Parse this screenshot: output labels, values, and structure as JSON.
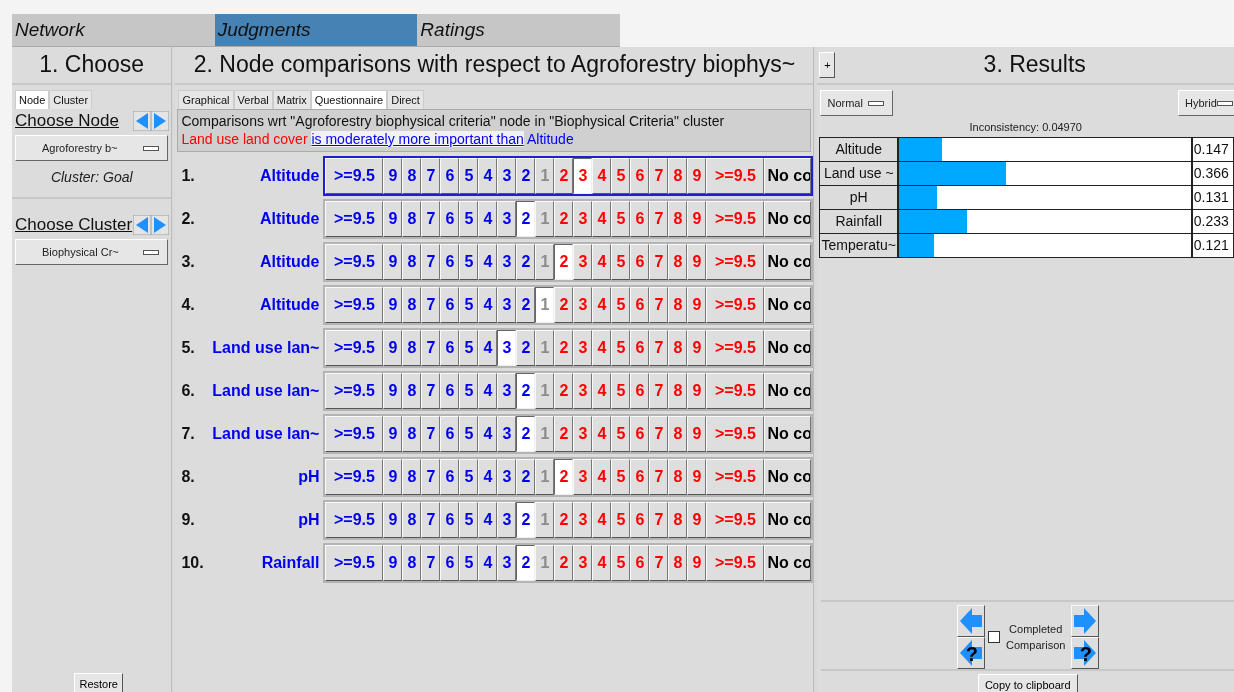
{
  "tabs": [
    {
      "label": "Network",
      "selected": false
    },
    {
      "label": "Judgments",
      "selected": true
    },
    {
      "label": "Ratings",
      "selected": false
    }
  ],
  "choose": {
    "title": "1. Choose",
    "tabs": [
      {
        "label": "Node",
        "selected": true
      },
      {
        "label": "Cluster",
        "selected": false
      }
    ],
    "node_heading": "Choose Node",
    "node_dropdown": "Agroforestry b~",
    "cluster_note": "Cluster: Goal",
    "cluster_heading": "Choose Cluster",
    "cluster_dropdown": "Biophysical Cr~",
    "restore_button": "Restore"
  },
  "comparisons": {
    "title": "2. Node comparisons with respect to Agroforestry biophys~",
    "tabs": [
      {
        "label": "Graphical",
        "selected": false
      },
      {
        "label": "Verbal",
        "selected": false
      },
      {
        "label": "Matrix",
        "selected": false
      },
      {
        "label": "Questionnaire",
        "selected": true
      },
      {
        "label": "Direct",
        "selected": false
      }
    ],
    "description": "Comparisons wrt \"Agroforestry biophysical criteria\" node in \"Biophysical Criteria\" cluster",
    "verbal": {
      "subject": "Land use land cover",
      "relation": "is moderately more important than",
      "object": "Altitude"
    },
    "rows": [
      {
        "number": "1.",
        "label": "Altitude",
        "current": true,
        "cells": [
          {
            "label": ">=9.5",
            "kind": "left",
            "selected": false
          },
          {
            "label": "9",
            "kind": "left",
            "selected": false
          },
          {
            "label": "8",
            "kind": "left",
            "selected": false
          },
          {
            "label": "7",
            "kind": "left",
            "selected": false
          },
          {
            "label": "6",
            "kind": "left",
            "selected": false
          },
          {
            "label": "5",
            "kind": "left",
            "selected": false
          },
          {
            "label": "4",
            "kind": "left",
            "selected": false
          },
          {
            "label": "3",
            "kind": "left",
            "selected": false
          },
          {
            "label": "2",
            "kind": "left",
            "selected": false
          },
          {
            "label": "1",
            "kind": "equal",
            "selected": false
          },
          {
            "label": "2",
            "kind": "right",
            "selected": false
          },
          {
            "label": "3",
            "kind": "right",
            "selected": true
          },
          {
            "label": "4",
            "kind": "right",
            "selected": false
          },
          {
            "label": "5",
            "kind": "right",
            "selected": false
          },
          {
            "label": "6",
            "kind": "right",
            "selected": false
          },
          {
            "label": "7",
            "kind": "right",
            "selected": false
          },
          {
            "label": "8",
            "kind": "right",
            "selected": false
          },
          {
            "label": "9",
            "kind": "right",
            "selected": false
          },
          {
            "label": ">=9.5",
            "kind": "right",
            "selected": false
          },
          {
            "label": "No co",
            "kind": "none",
            "selected": false
          }
        ]
      },
      {
        "number": "2.",
        "label": "Altitude",
        "current": false,
        "cells": [
          {
            "label": ">=9.5",
            "kind": "left",
            "selected": false
          },
          {
            "label": "9",
            "kind": "left",
            "selected": false
          },
          {
            "label": "8",
            "kind": "left",
            "selected": false
          },
          {
            "label": "7",
            "kind": "left",
            "selected": false
          },
          {
            "label": "6",
            "kind": "left",
            "selected": false
          },
          {
            "label": "5",
            "kind": "left",
            "selected": false
          },
          {
            "label": "4",
            "kind": "left",
            "selected": false
          },
          {
            "label": "3",
            "kind": "left",
            "selected": false
          },
          {
            "label": "2",
            "kind": "left",
            "selected": true
          },
          {
            "label": "1",
            "kind": "equal",
            "selected": false
          },
          {
            "label": "2",
            "kind": "right",
            "selected": false
          },
          {
            "label": "3",
            "kind": "right",
            "selected": false
          },
          {
            "label": "4",
            "kind": "right",
            "selected": false
          },
          {
            "label": "5",
            "kind": "right",
            "selected": false
          },
          {
            "label": "6",
            "kind": "right",
            "selected": false
          },
          {
            "label": "7",
            "kind": "right",
            "selected": false
          },
          {
            "label": "8",
            "kind": "right",
            "selected": false
          },
          {
            "label": "9",
            "kind": "right",
            "selected": false
          },
          {
            "label": ">=9.5",
            "kind": "right",
            "selected": false
          },
          {
            "label": "No co",
            "kind": "none",
            "selected": false
          }
        ]
      },
      {
        "number": "3.",
        "label": "Altitude",
        "current": false,
        "cells": [
          {
            "label": ">=9.5",
            "kind": "left",
            "selected": false
          },
          {
            "label": "9",
            "kind": "left",
            "selected": false
          },
          {
            "label": "8",
            "kind": "left",
            "selected": false
          },
          {
            "label": "7",
            "kind": "left",
            "selected": false
          },
          {
            "label": "6",
            "kind": "left",
            "selected": false
          },
          {
            "label": "5",
            "kind": "left",
            "selected": false
          },
          {
            "label": "4",
            "kind": "left",
            "selected": false
          },
          {
            "label": "3",
            "kind": "left",
            "selected": false
          },
          {
            "label": "2",
            "kind": "left",
            "selected": false
          },
          {
            "label": "1",
            "kind": "equal",
            "selected": false
          },
          {
            "label": "2",
            "kind": "right",
            "selected": true
          },
          {
            "label": "3",
            "kind": "right",
            "selected": false
          },
          {
            "label": "4",
            "kind": "right",
            "selected": false
          },
          {
            "label": "5",
            "kind": "right",
            "selected": false
          },
          {
            "label": "6",
            "kind": "right",
            "selected": false
          },
          {
            "label": "7",
            "kind": "right",
            "selected": false
          },
          {
            "label": "8",
            "kind": "right",
            "selected": false
          },
          {
            "label": "9",
            "kind": "right",
            "selected": false
          },
          {
            "label": ">=9.5",
            "kind": "right",
            "selected": false
          },
          {
            "label": "No co",
            "kind": "none",
            "selected": false
          }
        ]
      },
      {
        "number": "4.",
        "label": "Altitude",
        "current": false,
        "cells": [
          {
            "label": ">=9.5",
            "kind": "left",
            "selected": false
          },
          {
            "label": "9",
            "kind": "left",
            "selected": false
          },
          {
            "label": "8",
            "kind": "left",
            "selected": false
          },
          {
            "label": "7",
            "kind": "left",
            "selected": false
          },
          {
            "label": "6",
            "kind": "left",
            "selected": false
          },
          {
            "label": "5",
            "kind": "left",
            "selected": false
          },
          {
            "label": "4",
            "kind": "left",
            "selected": false
          },
          {
            "label": "3",
            "kind": "left",
            "selected": false
          },
          {
            "label": "2",
            "kind": "left",
            "selected": false
          },
          {
            "label": "1",
            "kind": "equal",
            "selected": true
          },
          {
            "label": "2",
            "kind": "right",
            "selected": false
          },
          {
            "label": "3",
            "kind": "right",
            "selected": false
          },
          {
            "label": "4",
            "kind": "right",
            "selected": false
          },
          {
            "label": "5",
            "kind": "right",
            "selected": false
          },
          {
            "label": "6",
            "kind": "right",
            "selected": false
          },
          {
            "label": "7",
            "kind": "right",
            "selected": false
          },
          {
            "label": "8",
            "kind": "right",
            "selected": false
          },
          {
            "label": "9",
            "kind": "right",
            "selected": false
          },
          {
            "label": ">=9.5",
            "kind": "right",
            "selected": false
          },
          {
            "label": "No co",
            "kind": "none",
            "selected": false
          }
        ]
      },
      {
        "number": "5.",
        "label": "Land use lan~",
        "current": false,
        "cells": [
          {
            "label": ">=9.5",
            "kind": "left",
            "selected": false
          },
          {
            "label": "9",
            "kind": "left",
            "selected": false
          },
          {
            "label": "8",
            "kind": "left",
            "selected": false
          },
          {
            "label": "7",
            "kind": "left",
            "selected": false
          },
          {
            "label": "6",
            "kind": "left",
            "selected": false
          },
          {
            "label": "5",
            "kind": "left",
            "selected": false
          },
          {
            "label": "4",
            "kind": "left",
            "selected": false
          },
          {
            "label": "3",
            "kind": "left",
            "selected": true
          },
          {
            "label": "2",
            "kind": "left",
            "selected": false
          },
          {
            "label": "1",
            "kind": "equal",
            "selected": false
          },
          {
            "label": "2",
            "kind": "right",
            "selected": false
          },
          {
            "label": "3",
            "kind": "right",
            "selected": false
          },
          {
            "label": "4",
            "kind": "right",
            "selected": false
          },
          {
            "label": "5",
            "kind": "right",
            "selected": false
          },
          {
            "label": "6",
            "kind": "right",
            "selected": false
          },
          {
            "label": "7",
            "kind": "right",
            "selected": false
          },
          {
            "label": "8",
            "kind": "right",
            "selected": false
          },
          {
            "label": "9",
            "kind": "right",
            "selected": false
          },
          {
            "label": ">=9.5",
            "kind": "right",
            "selected": false
          },
          {
            "label": "No co",
            "kind": "none",
            "selected": false
          }
        ]
      },
      {
        "number": "6.",
        "label": "Land use lan~",
        "current": false,
        "cells": [
          {
            "label": ">=9.5",
            "kind": "left",
            "selected": false
          },
          {
            "label": "9",
            "kind": "left",
            "selected": false
          },
          {
            "label": "8",
            "kind": "left",
            "selected": false
          },
          {
            "label": "7",
            "kind": "left",
            "selected": false
          },
          {
            "label": "6",
            "kind": "left",
            "selected": false
          },
          {
            "label": "5",
            "kind": "left",
            "selected": false
          },
          {
            "label": "4",
            "kind": "left",
            "selected": false
          },
          {
            "label": "3",
            "kind": "left",
            "selected": false
          },
          {
            "label": "2",
            "kind": "left",
            "selected": true
          },
          {
            "label": "1",
            "kind": "equal",
            "selected": false
          },
          {
            "label": "2",
            "kind": "right",
            "selected": false
          },
          {
            "label": "3",
            "kind": "right",
            "selected": false
          },
          {
            "label": "4",
            "kind": "right",
            "selected": false
          },
          {
            "label": "5",
            "kind": "right",
            "selected": false
          },
          {
            "label": "6",
            "kind": "right",
            "selected": false
          },
          {
            "label": "7",
            "kind": "right",
            "selected": false
          },
          {
            "label": "8",
            "kind": "right",
            "selected": false
          },
          {
            "label": "9",
            "kind": "right",
            "selected": false
          },
          {
            "label": ">=9.5",
            "kind": "right",
            "selected": false
          },
          {
            "label": "No co",
            "kind": "none",
            "selected": false
          }
        ]
      },
      {
        "number": "7.",
        "label": "Land use lan~",
        "current": false,
        "cells": [
          {
            "label": ">=9.5",
            "kind": "left",
            "selected": false
          },
          {
            "label": "9",
            "kind": "left",
            "selected": false
          },
          {
            "label": "8",
            "kind": "left",
            "selected": false
          },
          {
            "label": "7",
            "kind": "left",
            "selected": false
          },
          {
            "label": "6",
            "kind": "left",
            "selected": false
          },
          {
            "label": "5",
            "kind": "left",
            "selected": false
          },
          {
            "label": "4",
            "kind": "left",
            "selected": false
          },
          {
            "label": "3",
            "kind": "left",
            "selected": false
          },
          {
            "label": "2",
            "kind": "left",
            "selected": true
          },
          {
            "label": "1",
            "kind": "equal",
            "selected": false
          },
          {
            "label": "2",
            "kind": "right",
            "selected": false
          },
          {
            "label": "3",
            "kind": "right",
            "selected": false
          },
          {
            "label": "4",
            "kind": "right",
            "selected": false
          },
          {
            "label": "5",
            "kind": "right",
            "selected": false
          },
          {
            "label": "6",
            "kind": "right",
            "selected": false
          },
          {
            "label": "7",
            "kind": "right",
            "selected": false
          },
          {
            "label": "8",
            "kind": "right",
            "selected": false
          },
          {
            "label": "9",
            "kind": "right",
            "selected": false
          },
          {
            "label": ">=9.5",
            "kind": "right",
            "selected": false
          },
          {
            "label": "No co",
            "kind": "none",
            "selected": false
          }
        ]
      },
      {
        "number": "8.",
        "label": "pH",
        "current": false,
        "cells": [
          {
            "label": ">=9.5",
            "kind": "left",
            "selected": false
          },
          {
            "label": "9",
            "kind": "left",
            "selected": false
          },
          {
            "label": "8",
            "kind": "left",
            "selected": false
          },
          {
            "label": "7",
            "kind": "left",
            "selected": false
          },
          {
            "label": "6",
            "kind": "left",
            "selected": false
          },
          {
            "label": "5",
            "kind": "left",
            "selected": false
          },
          {
            "label": "4",
            "kind": "left",
            "selected": false
          },
          {
            "label": "3",
            "kind": "left",
            "selected": false
          },
          {
            "label": "2",
            "kind": "left",
            "selected": false
          },
          {
            "label": "1",
            "kind": "equal",
            "selected": false
          },
          {
            "label": "2",
            "kind": "right",
            "selected": true
          },
          {
            "label": "3",
            "kind": "right",
            "selected": false
          },
          {
            "label": "4",
            "kind": "right",
            "selected": false
          },
          {
            "label": "5",
            "kind": "right",
            "selected": false
          },
          {
            "label": "6",
            "kind": "right",
            "selected": false
          },
          {
            "label": "7",
            "kind": "right",
            "selected": false
          },
          {
            "label": "8",
            "kind": "right",
            "selected": false
          },
          {
            "label": "9",
            "kind": "right",
            "selected": false
          },
          {
            "label": ">=9.5",
            "kind": "right",
            "selected": false
          },
          {
            "label": "No co",
            "kind": "none",
            "selected": false
          }
        ]
      },
      {
        "number": "9.",
        "label": "pH",
        "current": false,
        "cells": [
          {
            "label": ">=9.5",
            "kind": "left",
            "selected": false
          },
          {
            "label": "9",
            "kind": "left",
            "selected": false
          },
          {
            "label": "8",
            "kind": "left",
            "selected": false
          },
          {
            "label": "7",
            "kind": "left",
            "selected": false
          },
          {
            "label": "6",
            "kind": "left",
            "selected": false
          },
          {
            "label": "5",
            "kind": "left",
            "selected": false
          },
          {
            "label": "4",
            "kind": "left",
            "selected": false
          },
          {
            "label": "3",
            "kind": "left",
            "selected": false
          },
          {
            "label": "2",
            "kind": "left",
            "selected": true
          },
          {
            "label": "1",
            "kind": "equal",
            "selected": false
          },
          {
            "label": "2",
            "kind": "right",
            "selected": false
          },
          {
            "label": "3",
            "kind": "right",
            "selected": false
          },
          {
            "label": "4",
            "kind": "right",
            "selected": false
          },
          {
            "label": "5",
            "kind": "right",
            "selected": false
          },
          {
            "label": "6",
            "kind": "right",
            "selected": false
          },
          {
            "label": "7",
            "kind": "right",
            "selected": false
          },
          {
            "label": "8",
            "kind": "right",
            "selected": false
          },
          {
            "label": "9",
            "kind": "right",
            "selected": false
          },
          {
            "label": ">=9.5",
            "kind": "right",
            "selected": false
          },
          {
            "label": "No co",
            "kind": "none",
            "selected": false
          }
        ]
      },
      {
        "number": "10.",
        "label": "Rainfall",
        "current": false,
        "cells": [
          {
            "label": ">=9.5",
            "kind": "left",
            "selected": false
          },
          {
            "label": "9",
            "kind": "left",
            "selected": false
          },
          {
            "label": "8",
            "kind": "left",
            "selected": false
          },
          {
            "label": "7",
            "kind": "left",
            "selected": false
          },
          {
            "label": "6",
            "kind": "left",
            "selected": false
          },
          {
            "label": "5",
            "kind": "left",
            "selected": false
          },
          {
            "label": "4",
            "kind": "left",
            "selected": false
          },
          {
            "label": "3",
            "kind": "left",
            "selected": false
          },
          {
            "label": "2",
            "kind": "left",
            "selected": true
          },
          {
            "label": "1",
            "kind": "equal",
            "selected": false
          },
          {
            "label": "2",
            "kind": "right",
            "selected": false
          },
          {
            "label": "3",
            "kind": "right",
            "selected": false
          },
          {
            "label": "4",
            "kind": "right",
            "selected": false
          },
          {
            "label": "5",
            "kind": "right",
            "selected": false
          },
          {
            "label": "6",
            "kind": "right",
            "selected": false
          },
          {
            "label": "7",
            "kind": "right",
            "selected": false
          },
          {
            "label": "8",
            "kind": "right",
            "selected": false
          },
          {
            "label": "9",
            "kind": "right",
            "selected": false
          },
          {
            "label": ">=9.5",
            "kind": "right",
            "selected": false
          },
          {
            "label": "No co",
            "kind": "none",
            "selected": false
          }
        ]
      }
    ]
  },
  "results": {
    "expand_button": "+",
    "title": "3. Results",
    "mode_dropdown": "Normal",
    "method_dropdown": "Hybrid",
    "inconsistency": "Inconsistency: 0.04970",
    "items": [
      {
        "label": "Altitude",
        "level": 0.147,
        "value": "0.147"
      },
      {
        "label": "Land use ~",
        "level": 0.366,
        "value": "0.366"
      },
      {
        "label": "pH",
        "level": 0.131,
        "value": "0.131"
      },
      {
        "label": "Rainfall",
        "level": 0.233,
        "value": "0.233"
      },
      {
        "label": "Temperatu~",
        "level": 0.121,
        "value": "0.121"
      }
    ],
    "nav_buttons": [
      {
        "kind": "prev"
      },
      {
        "kind": "next"
      },
      {
        "kind": "prev",
        "label": "?"
      },
      {
        "kind": "next",
        "label": "?"
      }
    ],
    "completed": {
      "label": "Completed Comparison",
      "checked": false
    },
    "copy_button": "Copy to clipboard"
  }
}
